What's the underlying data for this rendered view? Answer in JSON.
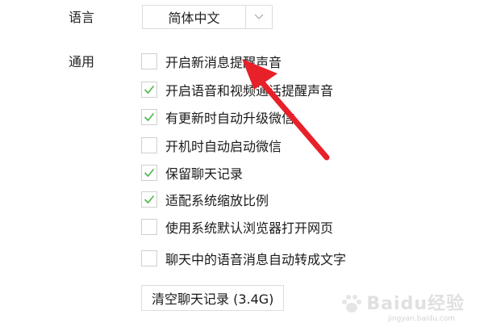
{
  "settings": {
    "language_label": "语言",
    "language_value": "简体中文",
    "general_label": "通用",
    "options": [
      {
        "label": "开启新消息提醒声音",
        "checked": false
      },
      {
        "label": "开启语音和视频通话提醒声音",
        "checked": true
      },
      {
        "label": "有更新时自动升级微信",
        "checked": true
      },
      {
        "label": "开机时自动启动微信",
        "checked": false
      },
      {
        "label": "保留聊天记录",
        "checked": true
      },
      {
        "label": "适配系统缩放比例",
        "checked": true
      },
      {
        "label": "使用系统默认浏览器打开网页",
        "checked": false
      },
      {
        "label": "聊天中的语音消息自动转成文字",
        "checked": false
      }
    ],
    "clear_button_label": "清空聊天记录 (3.4G)"
  },
  "annotation": {
    "arrow_color": "#e8202a"
  },
  "watermark": {
    "text": "Baidu经验",
    "sub": "jingyan.baidu.com"
  },
  "colors": {
    "check_mark": "#4cb84c",
    "border": "#dcdcdc"
  }
}
